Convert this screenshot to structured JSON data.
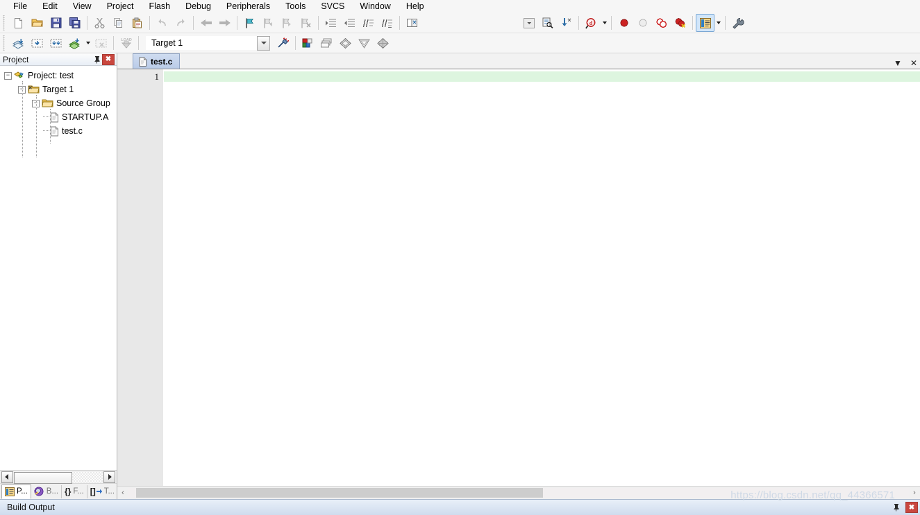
{
  "window": {
    "title": "Keil uVision"
  },
  "menubar": {
    "items": [
      {
        "label": "File"
      },
      {
        "label": "Edit"
      },
      {
        "label": "View"
      },
      {
        "label": "Project"
      },
      {
        "label": "Flash"
      },
      {
        "label": "Debug"
      },
      {
        "label": "Peripherals"
      },
      {
        "label": "Tools"
      },
      {
        "label": "SVCS"
      },
      {
        "label": "Window"
      },
      {
        "label": "Help"
      }
    ]
  },
  "toolbar_file": {
    "groups": [
      {
        "buttons": [
          {
            "name": "new-file-icon",
            "tooltip": "New"
          },
          {
            "name": "open-file-icon",
            "tooltip": "Open"
          },
          {
            "name": "save-icon",
            "tooltip": "Save"
          },
          {
            "name": "save-all-icon",
            "tooltip": "Save All"
          }
        ]
      },
      {
        "buttons": [
          {
            "name": "cut-icon",
            "tooltip": "Cut"
          },
          {
            "name": "copy-icon",
            "tooltip": "Copy"
          },
          {
            "name": "paste-icon",
            "tooltip": "Paste"
          }
        ]
      },
      {
        "buttons": [
          {
            "name": "undo-icon",
            "tooltip": "Undo"
          },
          {
            "name": "redo-icon",
            "tooltip": "Redo"
          }
        ]
      },
      {
        "buttons": [
          {
            "name": "navigate-back-icon",
            "tooltip": "Back"
          },
          {
            "name": "navigate-forward-icon",
            "tooltip": "Forward"
          }
        ]
      },
      {
        "buttons": [
          {
            "name": "toggle-bookmark-icon",
            "tooltip": "Insert/Remove Bookmark"
          },
          {
            "name": "previous-bookmark-icon",
            "tooltip": "Previous Bookmark"
          },
          {
            "name": "next-bookmark-icon",
            "tooltip": "Next Bookmark"
          },
          {
            "name": "clear-bookmarks-icon",
            "tooltip": "Clear All Bookmarks"
          }
        ]
      },
      {
        "buttons": [
          {
            "name": "indent-right-icon",
            "tooltip": "Indent Selected Text"
          },
          {
            "name": "indent-left-icon",
            "tooltip": "Unindent Selected Text"
          },
          {
            "name": "comment-selection-icon",
            "tooltip": "Comment Selection"
          },
          {
            "name": "uncomment-selection-icon",
            "tooltip": "Uncomment Selection"
          }
        ]
      },
      {
        "buttons": [
          {
            "name": "open-documentation-icon",
            "tooltip": "Open Documentation"
          }
        ]
      }
    ],
    "right_groups": [
      {
        "buttons": [
          {
            "name": "dropdown-blank-icon",
            "tooltip": "Find Combo"
          },
          {
            "name": "find-in-files-icon",
            "tooltip": "Find in Files"
          },
          {
            "name": "bookmark-goto-icon",
            "tooltip": "Go To Definition"
          }
        ]
      },
      {
        "buttons": [
          {
            "name": "find-icon",
            "tooltip": "Find"
          }
        ],
        "has_caret": true
      },
      {
        "buttons": [
          {
            "name": "insert-breakpoint-icon",
            "tooltip": "Insert/Remove Breakpoint"
          },
          {
            "name": "disable-breakpoint-icon",
            "tooltip": "Enable/Disable Breakpoint"
          },
          {
            "name": "disable-all-breakpoints-icon",
            "tooltip": "Disable All Breakpoints"
          },
          {
            "name": "kill-all-breakpoints-icon",
            "tooltip": "Kill All Breakpoints"
          }
        ]
      },
      {
        "buttons": [
          {
            "name": "project-window-icon",
            "tooltip": "Project Window",
            "selected": true
          }
        ],
        "has_caret": true
      },
      {
        "buttons": [
          {
            "name": "configure-icon",
            "tooltip": "Configuration"
          }
        ]
      }
    ]
  },
  "toolbar_build": {
    "left_buttons": [
      {
        "name": "translate-file-icon",
        "tooltip": "Translate Current File"
      },
      {
        "name": "build-target-icon",
        "tooltip": "Build Target"
      },
      {
        "name": "rebuild-all-icon",
        "tooltip": "Rebuild All Target Files"
      },
      {
        "name": "batch-build-icon",
        "tooltip": "Batch Build"
      }
    ],
    "stop_button": {
      "name": "stop-build-icon",
      "tooltip": "Stop Build"
    },
    "download_button": {
      "name": "download-icon",
      "tooltip": "Download"
    },
    "target_select": {
      "name": "target-selector",
      "value": "Target 1",
      "options": [
        "Target 1"
      ]
    },
    "right_buttons": [
      {
        "name": "options-for-target-icon",
        "tooltip": "Options for Target"
      },
      {
        "name": "manage-project-items-icon",
        "tooltip": "Manage Project Items"
      },
      {
        "name": "manage-run-time-env-icon",
        "tooltip": "Manage Run-Time Environment"
      },
      {
        "name": "select-software-packs-icon",
        "tooltip": "Select Software Packs"
      },
      {
        "name": "pack-installer-icon",
        "tooltip": "Pack Installer"
      },
      {
        "name": "multi-project-icon",
        "tooltip": "Multi-Project"
      }
    ]
  },
  "project_panel": {
    "title": "Project",
    "pin_icon": "pin-icon",
    "close_label": "✖",
    "tree": [
      {
        "label": "Project: test",
        "level": 0,
        "expander": "−",
        "icon": "project-icon"
      },
      {
        "label": "Target 1",
        "level": 1,
        "expander": "−",
        "icon": "target-folder-icon"
      },
      {
        "label": "Source Group",
        "level": 2,
        "expander": "−",
        "icon": "source-group-folder-icon"
      },
      {
        "label": "STARTUP.A",
        "level": 3,
        "expander": "",
        "icon": "file-icon"
      },
      {
        "label": "test.c",
        "level": 3,
        "expander": "",
        "icon": "file-icon"
      }
    ],
    "bottom_tabs": [
      {
        "label": "P...",
        "icon": "project-tab-icon",
        "active": true
      },
      {
        "label": "B...",
        "icon": "books-tab-icon",
        "active": false
      },
      {
        "label": "F...",
        "icon": "functions-tab-icon",
        "active": false,
        "prefix": "{}"
      },
      {
        "label": "T...",
        "icon": "templates-tab-icon",
        "active": false,
        "prefix": "[]"
      }
    ]
  },
  "editor": {
    "tabs": [
      {
        "label": "test.c",
        "icon": "file-icon",
        "active": true
      }
    ],
    "tab_controls": {
      "dropdown_label": "▼",
      "close_label": "✕"
    },
    "lines": [
      {
        "number": "1",
        "text": "",
        "highlighted": true
      }
    ]
  },
  "build_output": {
    "title": "Build Output",
    "pin_icon": "pin-icon",
    "close_label": "✖"
  },
  "watermark": {
    "text": "https://blog.csdn.net/qq_44366571"
  },
  "colors": {
    "accent": "#b9cbe8",
    "current_line": "#ddf5df",
    "panel_header": "#cfdcee",
    "close_red": "#c9473f",
    "breakpoint_red": "#cc2222"
  }
}
